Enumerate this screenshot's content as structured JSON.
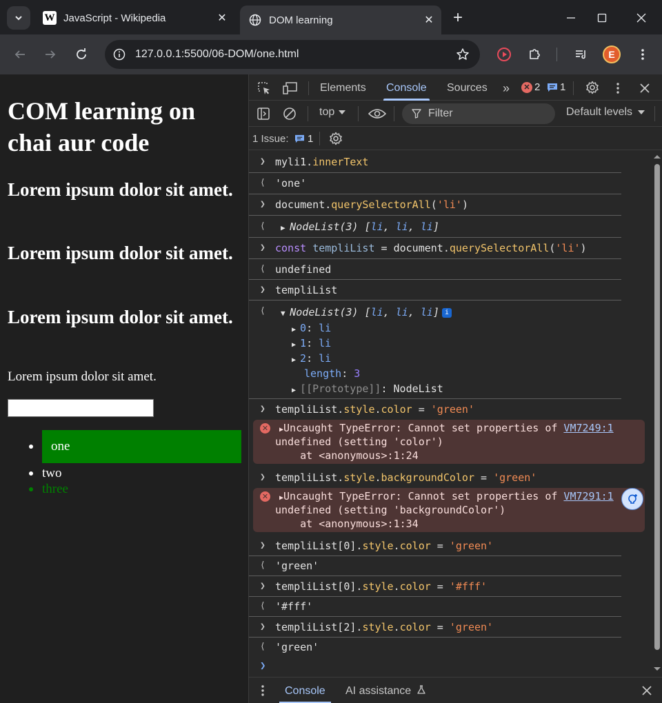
{
  "browser": {
    "tabs": [
      {
        "title": "JavaScript - Wikipedia",
        "favicon": "wikipedia-icon",
        "active": false
      },
      {
        "title": "DOM learning",
        "favicon": "globe-icon",
        "active": true
      }
    ],
    "url": "127.0.0.1:5500/06-DOM/one.html",
    "avatar_letter": "E"
  },
  "page": {
    "h1": "COM learning on chai aur code",
    "h2_items": [
      "Lorem ipsum dolor sit amet.",
      "Lorem ipsum dolor sit amet.",
      "Lorem ipsum dolor sit amet."
    ],
    "paragraph": "Lorem ipsum dolor sit amet.",
    "input_value": "",
    "list": [
      "one",
      "two",
      "three"
    ],
    "colors": {
      "highlight": "#008000",
      "text": "#ffffff"
    }
  },
  "devtools": {
    "tabs": [
      "Elements",
      "Console",
      "Sources"
    ],
    "active_tab": "Console",
    "error_count": "2",
    "message_count": "1",
    "context": "top",
    "filter_placeholder": "Filter",
    "levels": "Default levels",
    "issues_label": "1 Issue:",
    "issues_count": "1",
    "drawer_tabs": [
      "Console",
      "AI assistance"
    ]
  },
  "console": {
    "r1_in": "myli1.innerText",
    "r1_out": "'one'",
    "r2_in": "document.querySelectorAll('li')",
    "r2_out": "NodeList(3) [li, li, li]",
    "r3_in": "const templiList = document.querySelectorAll('li')",
    "r3_out": "undefined",
    "r4_in": "templiList",
    "r4_out": "NodeList(3) [li, li, li]",
    "r4_items": [
      "0: li",
      "1: li",
      "2: li"
    ],
    "r4_length": "length: 3",
    "r4_proto": "[[Prototype]]: NodeList",
    "r5_in": "templiList.style.color = 'green'",
    "err1_msg": "Uncaught TypeError: Cannot set properties of",
    "err1_link": "VM7249:1",
    "err1_line2": "undefined (setting 'color')",
    "err1_line3": "    at <anonymous>:1:24",
    "r6_in": "templiList.style.backgroundColor = 'green'",
    "err2_msg": "Uncaught TypeError: Cannot set properties of",
    "err2_link": "VM7291:1",
    "err2_line2": "undefined (setting 'backgroundColor')",
    "err2_line3": "    at <anonymous>:1:34",
    "r7_in": "templiList[0].style.color = 'green'",
    "r7_out": "'green'",
    "r8_in": "templiList[0].style.color = '#fff'",
    "r8_out": "'#fff'",
    "r9_in": "templiList[2].style.color = 'green'",
    "r9_out": "'green'"
  }
}
